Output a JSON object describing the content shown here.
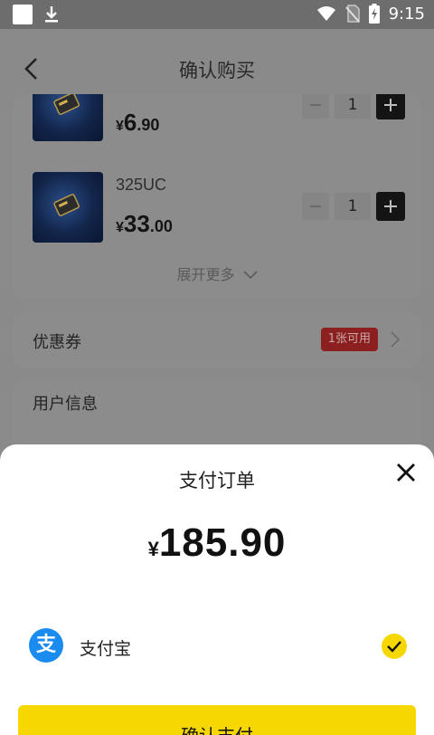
{
  "status_bar": {
    "time": "9:15"
  },
  "header": {
    "title": "确认购买"
  },
  "products": [
    {
      "name": "",
      "price_main": "6",
      "price_decimal": ".90",
      "qty": "1"
    },
    {
      "name": "325UC",
      "price_main": "33",
      "price_decimal": ".00",
      "qty": "1"
    }
  ],
  "currency": "¥",
  "expand_more": "展开更多",
  "coupon": {
    "label": "优惠券",
    "badge": "1张可用"
  },
  "user_info": {
    "label": "用户信息"
  },
  "sheet": {
    "title": "支付订单",
    "currency": "¥",
    "amount": "185.90",
    "method_label": "支付宝",
    "method_icon_glyph": "支",
    "confirm_label": "确认支付"
  },
  "colors": {
    "accent": "#f6d700",
    "alipay": "#1a8cf0",
    "coupon_badge": "#8c1f1f"
  }
}
